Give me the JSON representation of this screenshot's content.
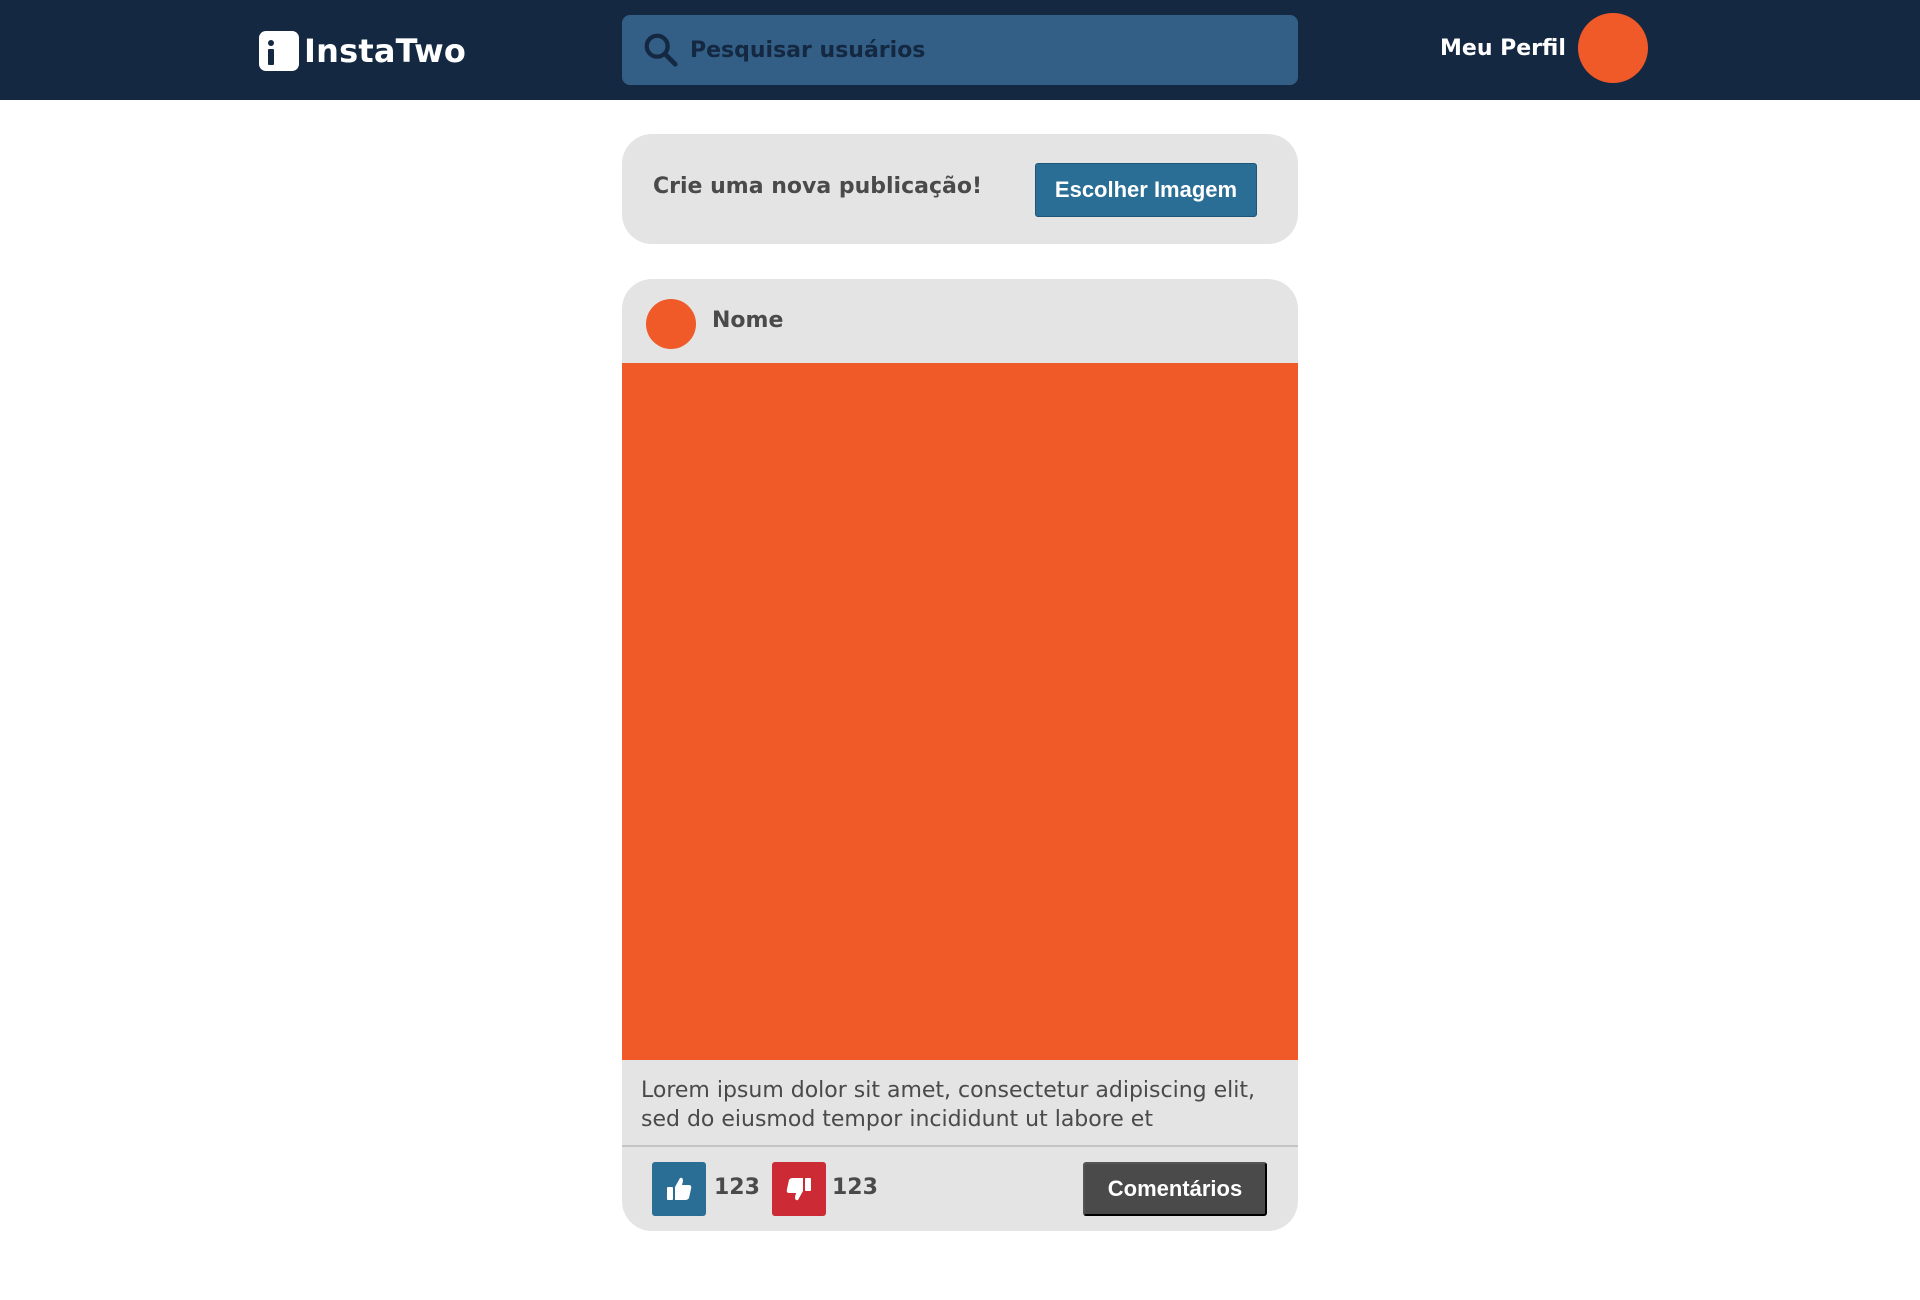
{
  "header": {
    "logo_text": "InstaTwo",
    "search_placeholder": "Pesquisar usuários",
    "profile_label": "Meu Perfil"
  },
  "composer": {
    "prompt": "Crie uma nova publicação!",
    "choose_image_label": "Escolher Imagem"
  },
  "post": {
    "author": "Nome",
    "caption": "Lorem ipsum dolor sit amet, consectetur adipiscing elit, sed do eiusmod tempor incididunt ut labore et",
    "likes": "123",
    "dislikes": "123",
    "comments_label": "Comentários"
  },
  "icons": {
    "logo": "logo-icon",
    "search": "search-icon",
    "like": "thumbs-up-icon",
    "dislike": "thumbs-down-icon"
  },
  "colors": {
    "header_bg": "#142841",
    "search_bg": "#335f86",
    "accent_orange": "#f05a28",
    "primary_blue": "#2a6e96",
    "danger_red": "#cc2a35",
    "card_bg": "#e4e4e4",
    "dark_gray": "#4a4a4a"
  }
}
